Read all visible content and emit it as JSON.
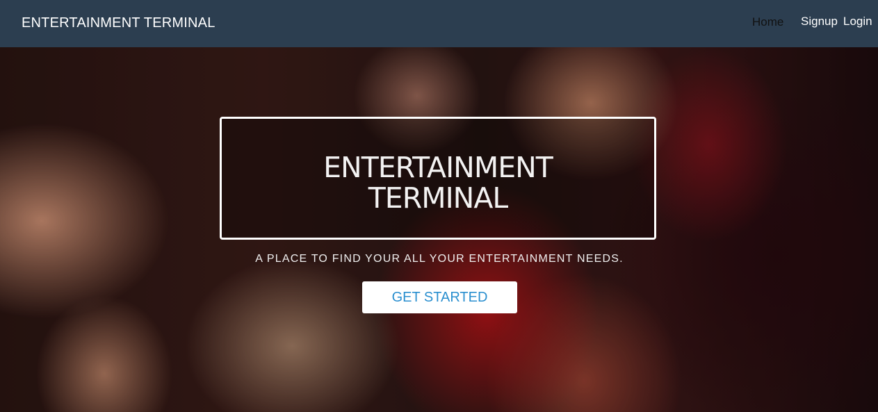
{
  "navbar": {
    "brand": "ENTERTAINMENT TERMINAL",
    "links": {
      "home": "Home",
      "signup": "Signup",
      "login": "Login"
    }
  },
  "hero": {
    "title_line1": "ENTERTAINMENT",
    "title_line2": "TERMINAL",
    "tagline": "A PLACE TO FIND YOUR ALL YOUR ENTERTAINMENT NEEDS.",
    "cta_label": "GET STARTED"
  },
  "colors": {
    "navbar_bg": "#2c3e50",
    "cta_text": "#2a8fcf",
    "cta_bg": "#ffffff"
  }
}
